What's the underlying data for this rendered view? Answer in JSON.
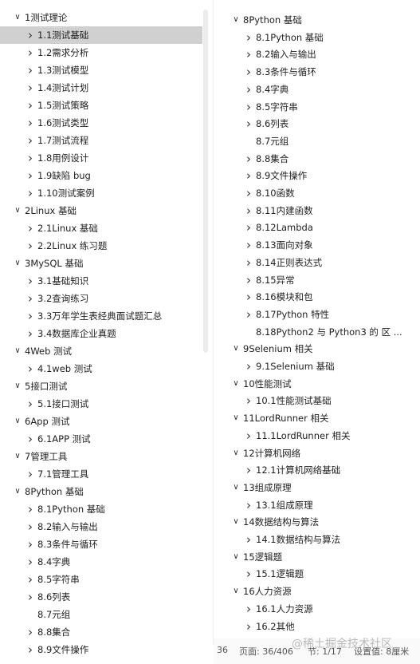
{
  "left_tree": [
    {
      "label": "1测试理论",
      "level": 0,
      "exp": "down"
    },
    {
      "label": "1.1测试基础",
      "level": 1,
      "exp": "right",
      "selected": true
    },
    {
      "label": "1.2需求分析",
      "level": 1,
      "exp": "right"
    },
    {
      "label": "1.3测试模型",
      "level": 1,
      "exp": "right"
    },
    {
      "label": "1.4测试计划",
      "level": 1,
      "exp": "right"
    },
    {
      "label": "1.5测试策略",
      "level": 1,
      "exp": "right"
    },
    {
      "label": "1.6测试类型",
      "level": 1,
      "exp": "right"
    },
    {
      "label": "1.7测试流程",
      "level": 1,
      "exp": "right"
    },
    {
      "label": "1.8用例设计",
      "level": 1,
      "exp": "right"
    },
    {
      "label": "1.9缺陷 bug",
      "level": 1,
      "exp": "right"
    },
    {
      "label": "1.10测试案例",
      "level": 1,
      "exp": "right"
    },
    {
      "label": "2Linux 基础",
      "level": 0,
      "exp": "down"
    },
    {
      "label": "2.1Linux 基础",
      "level": 1,
      "exp": "right"
    },
    {
      "label": "2.2Linux 练习题",
      "level": 1,
      "exp": "right"
    },
    {
      "label": "3MySQL 基础",
      "level": 0,
      "exp": "down"
    },
    {
      "label": "3.1基础知识",
      "level": 1,
      "exp": "right"
    },
    {
      "label": "3.2查询练习",
      "level": 1,
      "exp": "right"
    },
    {
      "label": "3.3万年学生表经典面试题汇总",
      "level": 1,
      "exp": "right"
    },
    {
      "label": "3.4数据库企业真题",
      "level": 1,
      "exp": "right"
    },
    {
      "label": "4Web 测试",
      "level": 0,
      "exp": "down"
    },
    {
      "label": "4.1web 测试",
      "level": 1,
      "exp": "right"
    },
    {
      "label": "5接口测试",
      "level": 0,
      "exp": "down"
    },
    {
      "label": "5.1接口测试",
      "level": 1,
      "exp": "right"
    },
    {
      "label": "6App 测试",
      "level": 0,
      "exp": "down"
    },
    {
      "label": "6.1APP 测试",
      "level": 1,
      "exp": "right"
    },
    {
      "label": "7管理工具",
      "level": 0,
      "exp": "down"
    },
    {
      "label": "7.1管理工具",
      "level": 1,
      "exp": "right"
    },
    {
      "label": "8Python 基础",
      "level": 0,
      "exp": "down"
    },
    {
      "label": "8.1Python 基础",
      "level": 1,
      "exp": "right"
    },
    {
      "label": "8.2输入与输出",
      "level": 1,
      "exp": "right"
    },
    {
      "label": "8.3条件与循环",
      "level": 1,
      "exp": "right"
    },
    {
      "label": "8.4字典",
      "level": 1,
      "exp": "right"
    },
    {
      "label": "8.5字符串",
      "level": 1,
      "exp": "right"
    },
    {
      "label": "8.6列表",
      "level": 1,
      "exp": "right"
    },
    {
      "label": "8.7元组",
      "level": 1,
      "exp": "none"
    },
    {
      "label": "8.8集合",
      "level": 1,
      "exp": "right"
    },
    {
      "label": "8.9文件操作",
      "level": 1,
      "exp": "right"
    }
  ],
  "right_tree": [
    {
      "label": "8Python 基础",
      "level": 0,
      "exp": "down"
    },
    {
      "label": "8.1Python 基础",
      "level": 1,
      "exp": "right"
    },
    {
      "label": "8.2输入与输出",
      "level": 1,
      "exp": "right"
    },
    {
      "label": "8.3条件与循环",
      "level": 1,
      "exp": "right"
    },
    {
      "label": "8.4字典",
      "level": 1,
      "exp": "right"
    },
    {
      "label": "8.5字符串",
      "level": 1,
      "exp": "right"
    },
    {
      "label": "8.6列表",
      "level": 1,
      "exp": "right"
    },
    {
      "label": "8.7元组",
      "level": 1,
      "exp": "none"
    },
    {
      "label": "8.8集合",
      "level": 1,
      "exp": "right"
    },
    {
      "label": "8.9文件操作",
      "level": 1,
      "exp": "right"
    },
    {
      "label": "8.10函数",
      "level": 1,
      "exp": "right"
    },
    {
      "label": "8.11内建函数",
      "level": 1,
      "exp": "right"
    },
    {
      "label": "8.12Lambda",
      "level": 1,
      "exp": "right"
    },
    {
      "label": "8.13面向对象",
      "level": 1,
      "exp": "right"
    },
    {
      "label": "8.14正则表达式",
      "level": 1,
      "exp": "right"
    },
    {
      "label": "8.15异常",
      "level": 1,
      "exp": "right"
    },
    {
      "label": "8.16模块和包",
      "level": 1,
      "exp": "right"
    },
    {
      "label": "8.17Python 特性",
      "level": 1,
      "exp": "right"
    },
    {
      "label": "8.18Python2 与 Python3 的 区 ...",
      "level": 1,
      "exp": "none"
    },
    {
      "label": "9Selenium 相关",
      "level": 0,
      "exp": "down"
    },
    {
      "label": "9.1Selenium 基础",
      "level": 1,
      "exp": "right"
    },
    {
      "label": "10性能测试",
      "level": 0,
      "exp": "down"
    },
    {
      "label": "10.1性能测试基础",
      "level": 1,
      "exp": "right"
    },
    {
      "label": "11LordRunner 相关",
      "level": 0,
      "exp": "down"
    },
    {
      "label": "11.1LordRunner 相关",
      "level": 1,
      "exp": "right"
    },
    {
      "label": "12计算机网络",
      "level": 0,
      "exp": "down"
    },
    {
      "label": "12.1计算机网络基础",
      "level": 1,
      "exp": "right"
    },
    {
      "label": "13组成原理",
      "level": 0,
      "exp": "down"
    },
    {
      "label": "13.1组成原理",
      "level": 1,
      "exp": "right"
    },
    {
      "label": "14数据结构与算法",
      "level": 0,
      "exp": "down"
    },
    {
      "label": "14.1数据结构与算法",
      "level": 1,
      "exp": "right"
    },
    {
      "label": "15逻辑题",
      "level": 0,
      "exp": "down"
    },
    {
      "label": "15.1逻辑题",
      "level": 1,
      "exp": "right"
    },
    {
      "label": "16人力资源",
      "level": 0,
      "exp": "down"
    },
    {
      "label": "16.1人力资源",
      "level": 1,
      "exp": "right"
    },
    {
      "label": "16.2其他",
      "level": 1,
      "exp": "right"
    }
  ],
  "status_bar": {
    "left_fragment": "36",
    "page": "页面: 36/406",
    "section": "节: 1/17",
    "position": "设置值: 8厘米"
  },
  "watermark": "@稀土掘金技术社区",
  "colors": {
    "selected_bg": "#d0d0d0",
    "text": "#1f1f1f",
    "chevron": "#333333"
  },
  "icons": {
    "expanded": "chevron-down-icon",
    "collapsed": "chevron-right-icon"
  }
}
